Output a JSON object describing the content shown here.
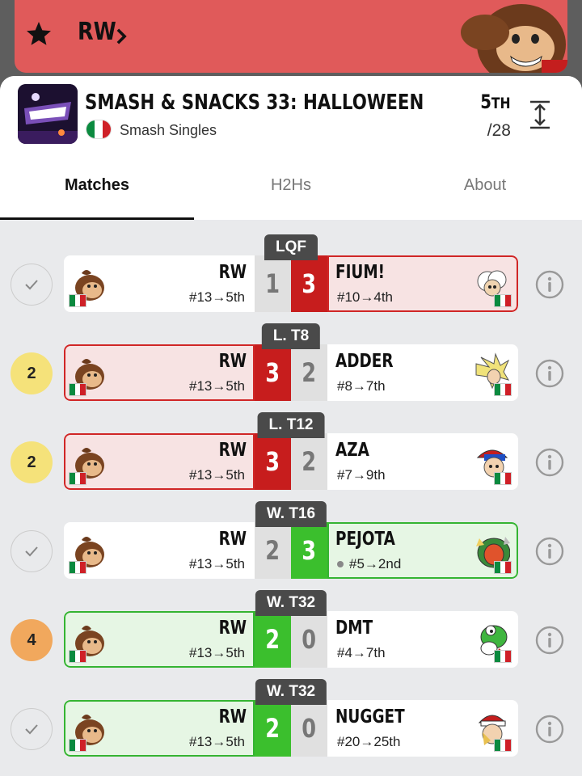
{
  "banner": {
    "player": "RW"
  },
  "tournament": {
    "name": "SMASH & SNACKS 33: HALLOWEEN",
    "event": "Smash Singles",
    "placement": "5",
    "placement_suffix": "TH",
    "entrants": "/28"
  },
  "tabs": [
    "Matches",
    "H2Hs",
    "About"
  ],
  "colors": {
    "win": "#3bbf2d",
    "loss": "#c71d1d",
    "banner": "#e05a5a"
  },
  "matches": [
    {
      "round": "LQF",
      "badge": "",
      "badge_type": "check",
      "p1": "RW",
      "p1_seed": "#13→5th",
      "p1_score": "1",
      "p2": "FIUM!",
      "p2_seed": "#10→4th",
      "p2_score": "3",
      "result": "loss",
      "p2_char": "fluffy-cloud-icon"
    },
    {
      "round": "L. T8",
      "badge": "2",
      "badge_type": "yellow",
      "p1": "RW",
      "p1_seed": "#13→5th",
      "p1_score": "3",
      "p2": "ADDER",
      "p2_seed": "#8→7th",
      "p2_score": "2",
      "result": "win",
      "p2_char": "spiky-hair-icon"
    },
    {
      "round": "L. T12",
      "badge": "2",
      "badge_type": "yellow",
      "p1": "RW",
      "p1_seed": "#13→5th",
      "p1_score": "3",
      "p2": "AZA",
      "p2_seed": "#7→9th",
      "p2_score": "2",
      "result": "win",
      "p2_char": "cap-kid-icon"
    },
    {
      "round": "W. T16",
      "badge": "",
      "badge_type": "check",
      "p1": "RW",
      "p1_seed": "#13→5th",
      "p1_score": "2",
      "p2": "PEJOTA",
      "p2_seed": "#5→2nd",
      "p2_score": "3",
      "result": "loss",
      "p2_char": "dragon-icon",
      "p2_dot": true
    },
    {
      "round": "W. T32",
      "badge": "4",
      "badge_type": "orange",
      "p1": "RW",
      "p1_seed": "#13→5th",
      "p1_score": "2",
      "p2": "DMT",
      "p2_seed": "#4→7th",
      "p2_score": "0",
      "result": "win",
      "p2_char": "yoshi-icon"
    },
    {
      "round": "W. T32",
      "badge": "",
      "badge_type": "check",
      "p1": "RW",
      "p1_seed": "#13→5th",
      "p1_score": "2",
      "p2": "NUGGET",
      "p2_seed": "#20→25th",
      "p2_score": "0",
      "result": "win",
      "p2_char": "cap-hero-icon"
    }
  ]
}
